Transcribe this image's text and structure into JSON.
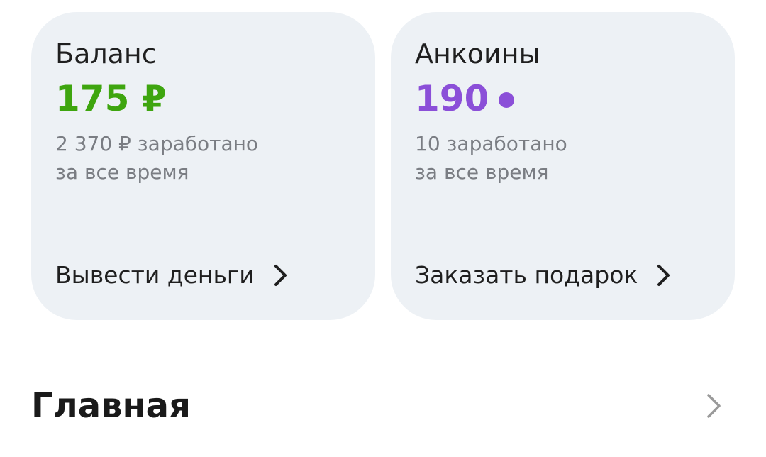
{
  "balance_card": {
    "title": "Баланс",
    "amount": "175 ₽",
    "earned_line1": "2 370 ₽ заработано",
    "earned_line2": "за все время",
    "action_label": "Вывести деньги",
    "amount_color": "#3ea50f"
  },
  "coins_card": {
    "title": "Анкоины",
    "amount": "190",
    "earned_line1": "10 заработано",
    "earned_line2": "за все время",
    "action_label": "Заказать подарок",
    "amount_color": "#8b4fd8",
    "coin_icon": "coin-dot-icon"
  },
  "section": {
    "title": "Главная",
    "icon": "chevron-right-icon"
  },
  "colors": {
    "card_background": "#edf1f5",
    "muted_text": "#7a7d83",
    "chevron_gray": "#9a9a9a"
  }
}
